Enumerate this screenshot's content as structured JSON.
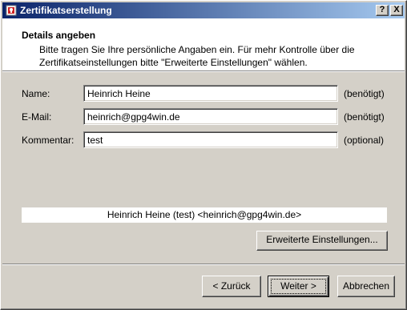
{
  "window": {
    "title": "Zertifikatserstellung",
    "help_button": "?",
    "close_button": "X"
  },
  "header": {
    "title": "Details angeben",
    "description": "Bitte tragen Sie Ihre persönliche Angaben ein. Für mehr Kontrolle über die Zertifikatseinstellungen bitte \"Erweiterte Einstellungen\" wählen."
  },
  "form": {
    "name": {
      "label": "Name:",
      "value": "Heinrich Heine",
      "hint": "(benötigt)"
    },
    "email": {
      "label": "E-Mail:",
      "value": "heinrich@gpg4win.de",
      "hint": "(benötigt)"
    },
    "comment": {
      "label": "Kommentar:",
      "value": "test",
      "hint": "(optional)"
    }
  },
  "preview": "Heinrich Heine (test) <heinrich@gpg4win.de>",
  "buttons": {
    "advanced": "Erweiterte Einstellungen...",
    "back": "< Zurück",
    "next": "Weiter >",
    "cancel": "Abbrechen"
  }
}
